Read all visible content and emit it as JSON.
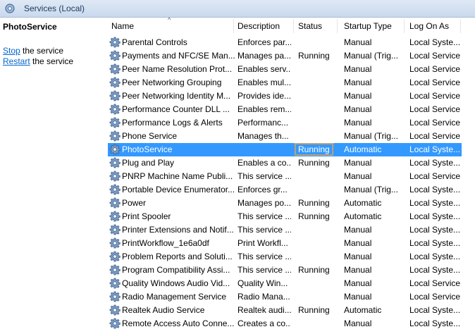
{
  "window": {
    "title": "Services (Local)"
  },
  "left_pane": {
    "service_name": "PhotoService",
    "stop_link": "Stop",
    "stop_text": " the service",
    "restart_link": "Restart",
    "restart_text": " the service"
  },
  "columns": [
    "Name",
    "Description",
    "Status",
    "Startup Type",
    "Log On As"
  ],
  "rows": [
    {
      "name": "Parental Controls",
      "desc": "Enforces par...",
      "status": "",
      "startup": "Manual",
      "logon": "Local Syste..."
    },
    {
      "name": "Payments and NFC/SE Man...",
      "desc": "Manages pa...",
      "status": "Running",
      "startup": "Manual (Trig...",
      "logon": "Local Service"
    },
    {
      "name": "Peer Name Resolution Prot...",
      "desc": "Enables serv...",
      "status": "",
      "startup": "Manual",
      "logon": "Local Service"
    },
    {
      "name": "Peer Networking Grouping",
      "desc": "Enables mul...",
      "status": "",
      "startup": "Manual",
      "logon": "Local Service"
    },
    {
      "name": "Peer Networking Identity M...",
      "desc": "Provides ide...",
      "status": "",
      "startup": "Manual",
      "logon": "Local Service"
    },
    {
      "name": "Performance Counter DLL ...",
      "desc": "Enables rem...",
      "status": "",
      "startup": "Manual",
      "logon": "Local Service"
    },
    {
      "name": "Performance Logs & Alerts",
      "desc": "Performanc...",
      "status": "",
      "startup": "Manual",
      "logon": "Local Service"
    },
    {
      "name": "Phone Service",
      "desc": "Manages th...",
      "status": "",
      "startup": "Manual (Trig...",
      "logon": "Local Service"
    },
    {
      "name": "PhotoService",
      "desc": "",
      "status": "Running",
      "startup": "Automatic",
      "logon": "Local Syste...",
      "selected": true
    },
    {
      "name": "Plug and Play",
      "desc": "Enables a co...",
      "status": "Running",
      "startup": "Manual",
      "logon": "Local Syste..."
    },
    {
      "name": "PNRP Machine Name Publi...",
      "desc": "This service ...",
      "status": "",
      "startup": "Manual",
      "logon": "Local Service"
    },
    {
      "name": "Portable Device Enumerator...",
      "desc": "Enforces gr...",
      "status": "",
      "startup": "Manual (Trig...",
      "logon": "Local Syste..."
    },
    {
      "name": "Power",
      "desc": "Manages po...",
      "status": "Running",
      "startup": "Automatic",
      "logon": "Local Syste..."
    },
    {
      "name": "Print Spooler",
      "desc": "This service ...",
      "status": "Running",
      "startup": "Automatic",
      "logon": "Local Syste..."
    },
    {
      "name": "Printer Extensions and Notif...",
      "desc": "This service ...",
      "status": "",
      "startup": "Manual",
      "logon": "Local Syste..."
    },
    {
      "name": "PrintWorkflow_1e6a0df",
      "desc": "Print Workfl...",
      "status": "",
      "startup": "Manual",
      "logon": "Local Syste..."
    },
    {
      "name": "Problem Reports and Soluti...",
      "desc": "This service ...",
      "status": "",
      "startup": "Manual",
      "logon": "Local Syste..."
    },
    {
      "name": "Program Compatibility Assi...",
      "desc": "This service ...",
      "status": "Running",
      "startup": "Manual",
      "logon": "Local Syste..."
    },
    {
      "name": "Quality Windows Audio Vid...",
      "desc": "Quality Win...",
      "status": "",
      "startup": "Manual",
      "logon": "Local Service"
    },
    {
      "name": "Radio Management Service",
      "desc": "Radio Mana...",
      "status": "",
      "startup": "Manual",
      "logon": "Local Service"
    },
    {
      "name": "Realtek Audio Service",
      "desc": "Realtek audi...",
      "status": "Running",
      "startup": "Automatic",
      "logon": "Local Syste..."
    },
    {
      "name": "Remote Access Auto Conne...",
      "desc": "Creates a co...",
      "status": "",
      "startup": "Manual",
      "logon": "Local Syste..."
    }
  ]
}
